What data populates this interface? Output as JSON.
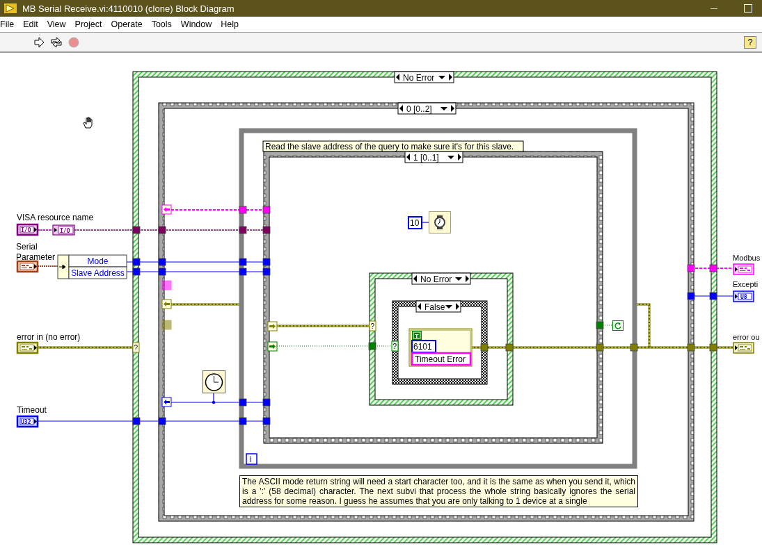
{
  "window": {
    "title": "MB Serial Receive.vi:4110010 (clone) Block Diagram"
  },
  "menu": [
    "File",
    "Edit",
    "View",
    "Project",
    "Operate",
    "Tools",
    "Window",
    "Help"
  ],
  "help_button": "?",
  "diagram": {
    "structures": [
      {
        "kind": "hatched_case",
        "selector": "No Error",
        "selector_terminal": "?"
      },
      {
        "kind": "sequence",
        "selector": "0 [0..2]"
      },
      {
        "kind": "while_loop",
        "iteration": "i"
      },
      {
        "kind": "sequence",
        "selector": "1 [0..1]"
      },
      {
        "kind": "hatched_case",
        "selector": "No Error",
        "selector_terminal": "?"
      },
      {
        "kind": "checkered_case",
        "selector": "False",
        "selector_terminal": "?"
      }
    ],
    "comments": [
      "Read the slave address of the query to make sure it's for this slave.",
      "The ASCII mode return string will need a start character too, and it is the same as when you send it, which is a ':' (58 decimal) character. The next subvi that process the whole string basically ignores the serial address for some reason. I guess he assumes that you are only talking to 1 device at a single"
    ],
    "inputs": [
      {
        "label": "VISA resource name",
        "kind": "refnum",
        "type": "I/O"
      },
      {
        "label": "Serial Parameter",
        "kind": "cluster"
      },
      {
        "label": "error in (no error)",
        "kind": "error"
      },
      {
        "label": "Timeout",
        "kind": "numeric",
        "type": "U32"
      }
    ],
    "outputs": [
      {
        "label": "Modbus",
        "kind": "string_cluster"
      },
      {
        "label": "Excepti",
        "kind": "numeric",
        "type": "U8"
      },
      {
        "label": "error ou",
        "kind": "error"
      }
    ],
    "visa_constant": "I/O",
    "unbundle": [
      "Mode",
      "Slave Address"
    ],
    "wait_constant": "10",
    "error_cluster": {
      "status": "T",
      "code": "6101",
      "source": "Timeout Error"
    }
  }
}
